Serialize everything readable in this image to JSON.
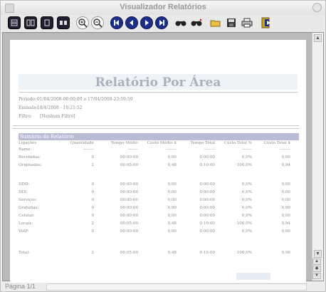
{
  "window": {
    "title": "Visualizador Relatórios"
  },
  "report": {
    "title": "Relatório Por Área",
    "meta": [
      {
        "label": "Período:",
        "value": "01/04/2008-00:00:00 a 17/04/2008-23:59:59"
      },
      {
        "label": "Emissão:",
        "value": "18/4/2008 - 10:21:52"
      },
      {
        "label": "Filtro:",
        "value": "[Nenhum Filtro]"
      }
    ],
    "summary_title": "Sumário do Relatório",
    "columns": [
      "Ligações",
      "Quantidade",
      "Tempo Médio",
      "Custo Médio $",
      "Tempo Total",
      "Custo Total %",
      "Custo Total $"
    ],
    "separator_row": [
      "Ramo:",
      "--------",
      "--------",
      "--------",
      "--------",
      "--------",
      "--------"
    ],
    "rows_group1": [
      [
        "Recebidas:",
        "0",
        "00:00:00",
        "0,00",
        "0:00:00",
        "0,0%",
        "0,00"
      ],
      [
        "Originadas:",
        "2",
        "00:05:00",
        "0,48",
        "0:10:00",
        "100,0%",
        "0,94"
      ]
    ],
    "rows_group2": [
      [
        "DDD:",
        "0",
        "00:00:00",
        "0,00",
        "0:00:00",
        "0,0%",
        "0,00"
      ],
      [
        "DDI:",
        "0",
        "00:00:00",
        "0,00",
        "0:00:00",
        "0,0%",
        "0,00"
      ],
      [
        "Serviços:",
        "0",
        "00:00:00",
        "0,00",
        "0:00:00",
        "0,0%",
        "0,00"
      ],
      [
        "Gratuitas:",
        "0",
        "00:00:00",
        "0,00",
        "0:00:00",
        "0,0%",
        "0,00"
      ],
      [
        "Celular:",
        "0",
        "00:00:00",
        "0,00",
        "0:00:00",
        "0,0%",
        "0,00"
      ],
      [
        "Locais:",
        "2",
        "00:05:00",
        "0,48",
        "0:10:00",
        "100,0%",
        "0,94"
      ],
      [
        "VoIP:",
        "0",
        "00:00:00",
        "0,00",
        "0:00:00",
        "0,0%",
        "0,00"
      ]
    ],
    "total_row": [
      "Total:",
      "2",
      "00:05:00",
      "0,48",
      "0:10:00",
      "100,0%",
      "0,96"
    ]
  },
  "statusbar": {
    "page_label": "Página 1/1"
  },
  "colors": {
    "summary_bar": "#b9bcd3",
    "title_text": "#aab0bc",
    "toolbar_nav_blue": "#1b2e8c"
  },
  "toolbar_icons": [
    "view-single-icon",
    "view-facing-icon",
    "view-fit-icon",
    "view-multi-icon",
    "zoom-in-icon",
    "zoom-out-icon",
    "first-page-icon",
    "prev-page-icon",
    "next-page-icon",
    "last-page-icon",
    "find-icon",
    "find-next-icon",
    "open-icon",
    "save-icon",
    "print-icon",
    "exit-icon"
  ]
}
